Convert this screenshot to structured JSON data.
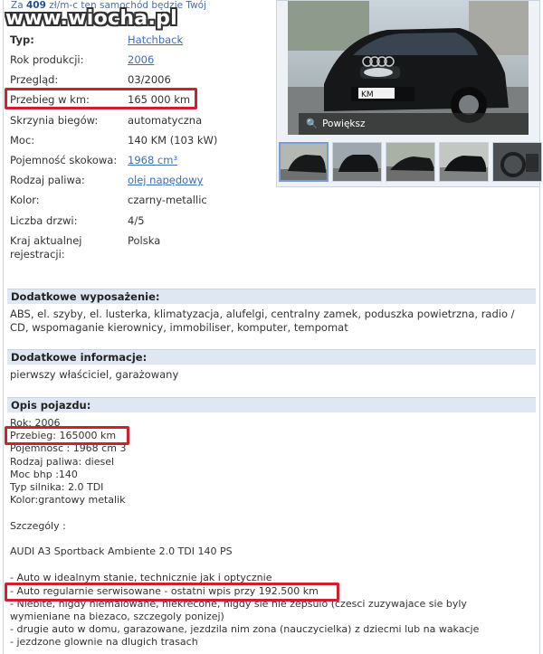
{
  "watermark": "www.wiocha.pl",
  "installment": {
    "prefix": "Za",
    "amount": "409",
    "suffix": "zł/m-c ten samochód będzie Twój"
  },
  "specs": [
    {
      "label": "Typ:",
      "value": "Hatchback",
      "link": true
    },
    {
      "label": "Rok produkcji:",
      "value": "2006",
      "link": true
    },
    {
      "label": "Przegląd:",
      "value": "03/2006",
      "link": false
    },
    {
      "label": "Przebieg w km:",
      "value": "165 000 km",
      "link": false
    },
    {
      "label": "Skrzynia biegów:",
      "value": "automatyczna",
      "link": false
    },
    {
      "label": "Moc:",
      "value": "140 KM (103 kW)",
      "link": false
    },
    {
      "label": "Pojemność skokowa:",
      "value": "1968 cm³",
      "link": true
    },
    {
      "label": "Rodzaj paliwa:",
      "value": "olej napędowy",
      "link": true
    },
    {
      "label": "Kolor:",
      "value": "czarny-metallic",
      "link": false
    },
    {
      "label": "Liczba drzwi:",
      "value": "4/5",
      "link": false
    },
    {
      "label": "Kraj aktualnej rejestracji:",
      "value": "Polska",
      "link": false
    }
  ],
  "gallery": {
    "zoom_label": "Powiększ",
    "plate_text": "KM"
  },
  "sections": {
    "equipment": {
      "title": "Dodatkowe wyposażenie:",
      "text": "ABS, el. szyby, el. lusterka, klimatyzacja, alufelgi, centralny zamek, poduszka powietrzna, radio / CD, wspomaganie kierownicy, immobiliser, komputer, tempomat"
    },
    "info": {
      "title": "Dodatkowe informacje:",
      "text": "pierwszy właściciel, garażowany"
    },
    "description": {
      "title": "Opis pojazdu:",
      "lines": [
        "Rok: 2006",
        "Przebieg: 165000 km",
        "Pojemnosc : 1968 cm 3",
        "Rodzaj paliwa: diesel",
        "Moc bhp :140",
        "Typ silnika: 2.0 TDI",
        "Kolor:grantowy metalik",
        "",
        "Szczególy :",
        "",
        "AUDI A3 Sportback Ambiente 2.0 TDI 140 PS",
        "",
        "- Auto w idealnym stanie, technicznie jak i optycznie",
        "- Auto regularnie serwisowane - ostatni wpis przy 192.500 km",
        "- Niebite, nigdy niemalowane, niekrecone, nigdy sie nie zepsulo (czesci zuzywajace sie byly",
        "wymieniane na biezaco, szczegoly ponizej)",
        "- drugie auto w domu, garazowane, jezdzila nim zona (nauczycielka) z dziecmi lub na wakacje",
        "- jezdzone glownie na dlugich trasach"
      ]
    }
  },
  "colors": {
    "highlight": "#d0202c",
    "link": "#3b6fb8",
    "section_bg": "#dfe7f2"
  }
}
